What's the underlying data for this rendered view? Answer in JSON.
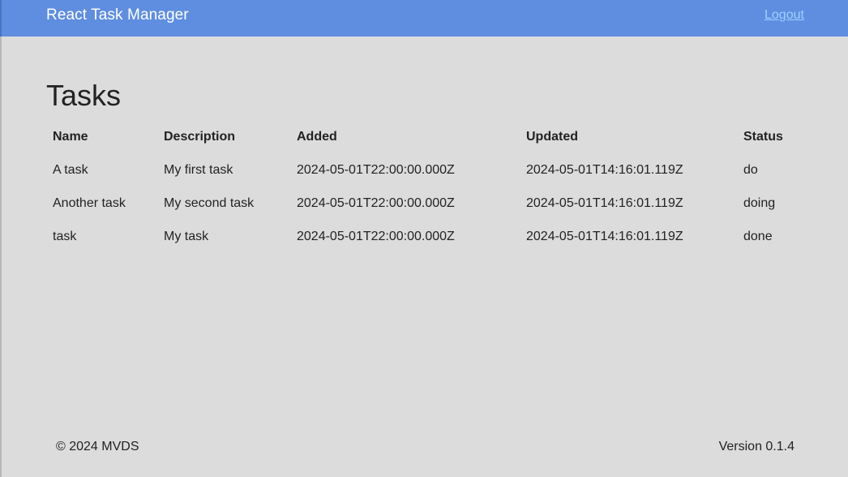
{
  "header": {
    "app_title": "React Task Manager",
    "logout_label": "Logout"
  },
  "main": {
    "page_title": "Tasks",
    "table": {
      "columns": [
        "Name",
        "Description",
        "Added",
        "Updated",
        "Status"
      ],
      "rows": [
        {
          "name": "A task",
          "description": "My first task",
          "added": "2024-05-01T22:00:00.000Z",
          "updated": "2024-05-01T14:16:01.119Z",
          "status": "do"
        },
        {
          "name": "Another task",
          "description": "My second task",
          "added": "2024-05-01T22:00:00.000Z",
          "updated": "2024-05-01T14:16:01.119Z",
          "status": "doing"
        },
        {
          "name": "task",
          "description": "My task",
          "added": "2024-05-01T22:00:00.000Z",
          "updated": "2024-05-01T14:16:01.119Z",
          "status": "done"
        }
      ]
    }
  },
  "footer": {
    "copyright": "© 2024 MVDS",
    "version": "Version 0.1.4"
  },
  "colors": {
    "header_bg": "#5f8ee0",
    "page_bg": "#dcdcdc",
    "logout_link": "#9fd0ff"
  }
}
